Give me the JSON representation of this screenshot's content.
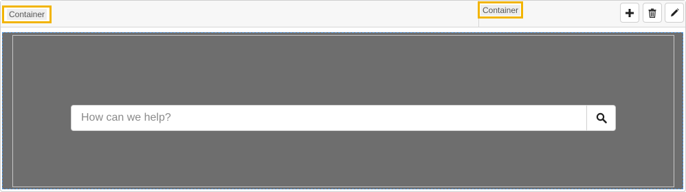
{
  "toolbar": {
    "left_label": "Container",
    "right_label": "Container",
    "add_icon": "plus-icon",
    "delete_icon": "trash-icon",
    "edit_icon": "pencil-icon"
  },
  "search": {
    "placeholder": "How can we help?",
    "value": "",
    "button_icon": "search-icon"
  },
  "colors": {
    "highlight": "#f2b400",
    "canvas": "#6e6e6e",
    "selection_border": "#4a90d9"
  }
}
